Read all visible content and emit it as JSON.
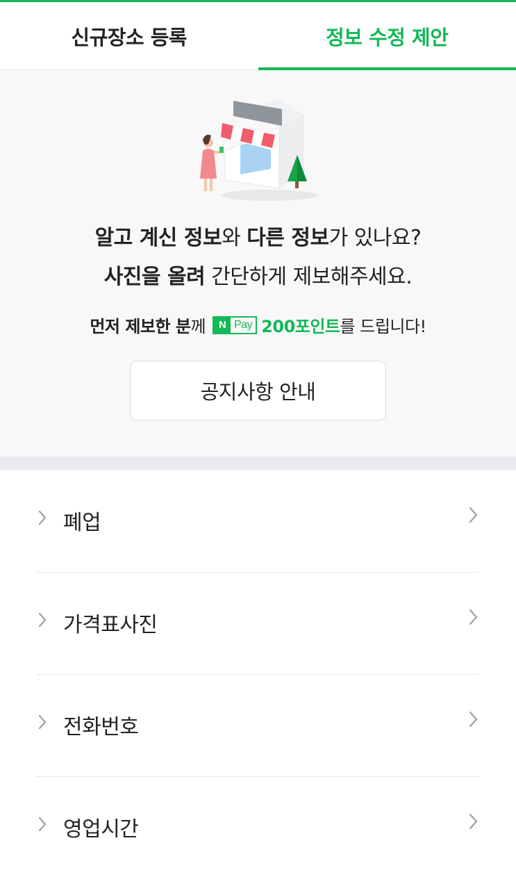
{
  "tabs": [
    {
      "label": "신규장소 등록",
      "active": false
    },
    {
      "label": "정보 수정 제안",
      "active": true
    }
  ],
  "hero": {
    "line1_bold1": "알고 계신 정보",
    "line1_normal1": "와 ",
    "line1_bold2": "다른 정보",
    "line1_normal2": "가 있나요?",
    "line2_bold": "사진을 올려",
    "line2_normal": " 간단하게 제보해주세요.",
    "reward_bold": "먼저 제보한 분",
    "reward_normal": "께",
    "npay_n": "N",
    "npay_pay": "Pay",
    "reward_points": "200포인트",
    "reward_tail": "를 드립니다!",
    "notice_button": "공지사항 안내"
  },
  "menu": {
    "items": [
      {
        "label": "폐업"
      },
      {
        "label": "가격표사진"
      },
      {
        "label": "전화번호"
      },
      {
        "label": "영업시간"
      }
    ]
  },
  "colors": {
    "accent": "#13b857",
    "hero_bg": "#f8f8f9",
    "divider": "#e9ebee"
  },
  "icons": {
    "illustration": "storefront-woman-illustration",
    "chevron": "chevron-right-icon"
  }
}
